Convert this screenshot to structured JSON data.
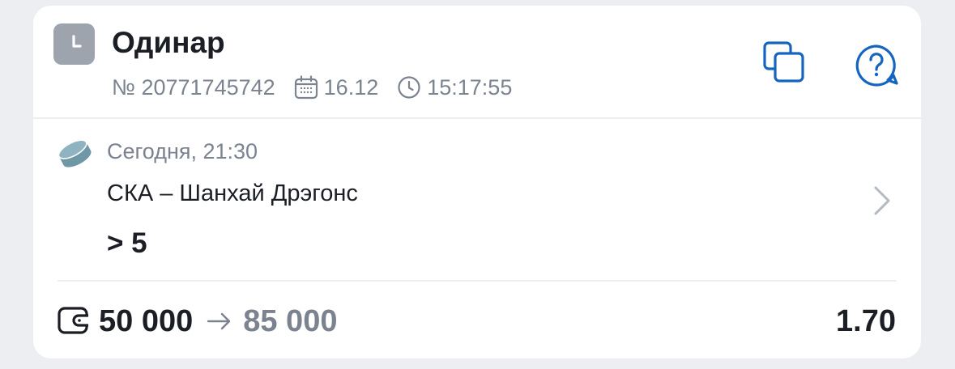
{
  "header": {
    "title": "Одинар",
    "bet_number": "№ 20771745742",
    "date": "16.12",
    "time": "15:17:55",
    "status_icon": "clock-icon",
    "actions": {
      "copy_icon": "copy-icon",
      "help_icon": "help-icon"
    }
  },
  "event": {
    "sport_icon": "hockey-puck-icon",
    "start_time": "Сегодня, 21:30",
    "name": "СКА – Шанхай Дрэгонс",
    "outcome": "> 5"
  },
  "footer": {
    "stake": "50 000",
    "payout": "85 000",
    "odds": "1.70"
  },
  "colors": {
    "accent": "#1565c0",
    "text_primary": "#1b1e24",
    "text_secondary": "#7b8290",
    "status_badge": "#9ea4ae",
    "puck": "#6f97a6",
    "background": "#eceef2",
    "card": "#ffffff"
  }
}
